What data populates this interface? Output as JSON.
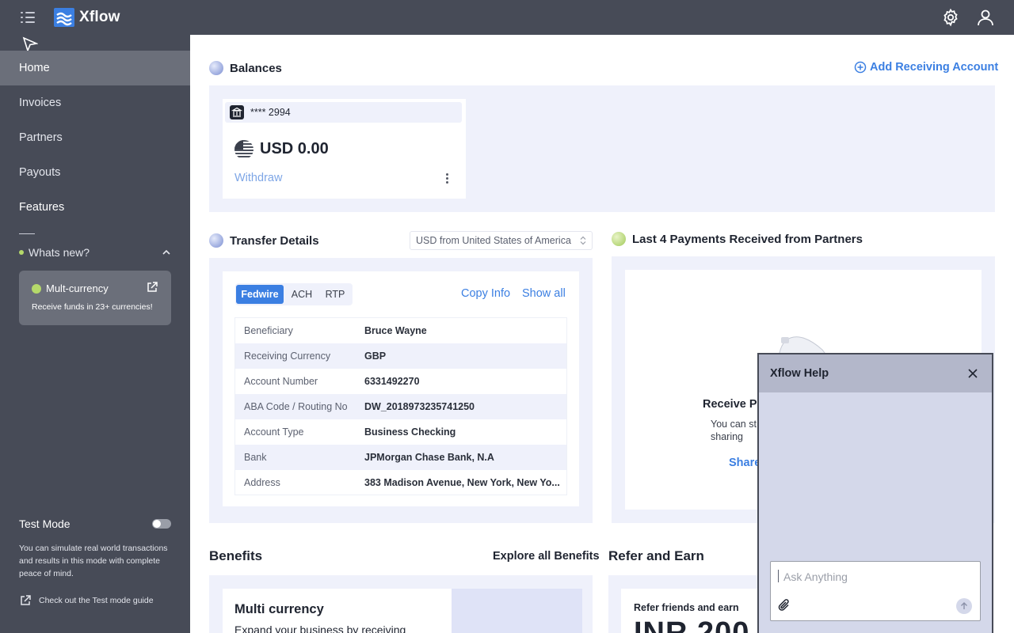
{
  "app": {
    "name": "Xflow"
  },
  "sidebar": {
    "items": [
      {
        "label": "Home",
        "active": true
      },
      {
        "label": "Invoices"
      },
      {
        "label": "Partners"
      },
      {
        "label": "Payouts"
      },
      {
        "label": "Features"
      }
    ],
    "whats_new": {
      "label": "Whats new?",
      "card": {
        "title": "Mult-currency",
        "description": "Receive funds in 23+ currencies!"
      }
    },
    "test_mode": {
      "label": "Test Mode",
      "enabled": false,
      "description": "You can simulate real world transactions and results in this mode with complete peace of mind.",
      "guide_link": "Check out the Test mode guide"
    }
  },
  "balances": {
    "title": "Balances",
    "add_account": "Add Receiving Account",
    "account": {
      "masked_number": "**** 2994",
      "amount": "USD 0.00",
      "withdraw": "Withdraw"
    }
  },
  "transfer": {
    "title": "Transfer Details",
    "select_value": "USD from United States of America",
    "tabs": [
      "Fedwire",
      "ACH",
      "RTP"
    ],
    "active_tab": "Fedwire",
    "copy_info": "Copy Info",
    "show_all": "Show all",
    "rows": [
      {
        "label": "Beneficiary",
        "value": "Bruce Wayne"
      },
      {
        "label": "Receiving Currency",
        "value": "GBP"
      },
      {
        "label": "Account Number",
        "value": "6331492270"
      },
      {
        "label": "ABA Code / Routing No",
        "value": "DW_2018973235741250"
      },
      {
        "label": "Account Type",
        "value": "Business Checking"
      },
      {
        "label": "Bank",
        "value": "JPMorgan Chase Bank, N.A"
      },
      {
        "label": "Address",
        "value": "383 Madison Avenue, New York, New Yo..."
      }
    ]
  },
  "payments": {
    "title": "Last 4 Payments Received from Partners",
    "empty_title": "Receive Pa",
    "empty_desc": "You can st sharing",
    "share": "Share"
  },
  "benefits": {
    "title": "Benefits",
    "explore": "Explore all Benefits",
    "card_title": "Multi currency",
    "card_desc": "Expand your business by receiving"
  },
  "refer": {
    "title": "Refer and Earn",
    "card_title": "Refer friends and earn",
    "amount": "INR 200"
  },
  "help": {
    "title": "Xflow Help",
    "placeholder": "Ask Anything"
  },
  "colors": {
    "sidebar": "#474b57",
    "accent": "#3b7fe2",
    "panel": "#eff1fb",
    "highlight_green": "#b5d96a"
  }
}
